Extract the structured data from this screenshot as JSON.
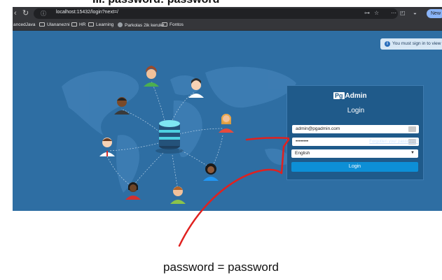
{
  "caption_top": "III.     password: password",
  "browser": {
    "nav": {
      "back_icon": "arrow-left-icon",
      "reload_icon": "reload-icon"
    },
    "url": "localhost:15432/login?next=/",
    "bookmarks": [
      "ancedJava",
      "Ulananezni",
      "HR",
      "Learning",
      "Parkolas 2ik kerulet",
      "Fontos"
    ],
    "new_button": "New"
  },
  "page": {
    "notice": "You must sign in to view",
    "login": {
      "logo_pg": "Pg",
      "logo_text": "Admin",
      "title": "Login",
      "email_value": "admin@pgadmin.com",
      "password_mask": "••••••••",
      "forgot_link": "Forgotten your password?",
      "language": "English",
      "button": "Login"
    }
  },
  "caption_bottom": "password = password",
  "colors": {
    "page_bg": "#2e6ea3",
    "login_button": "#0d8fd6",
    "annotation": "#e0211f"
  }
}
